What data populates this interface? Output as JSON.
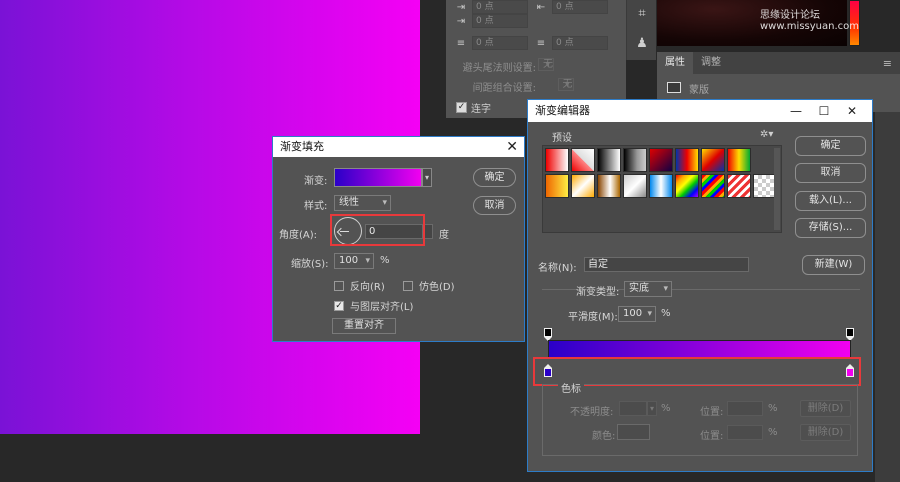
{
  "character_panel": {
    "field_1": "0 点",
    "field_2": "0 点",
    "field_3": "0 点",
    "field_4": "0 点",
    "field_5": "0 点",
    "hyphen_label": "避头尾法则设置:",
    "hyphen_value": "无",
    "spacing_label": "间距组合设置:",
    "spacing_value": "无",
    "ligature_label": "连字",
    "ligature_checked": true
  },
  "watermark": "思缘设计论坛 www.missyuan.com",
  "properties_panel": {
    "tabs": [
      "属性",
      "调整"
    ],
    "row_label": "蒙版"
  },
  "gradient_fill_dialog": {
    "title": "渐变填充",
    "gradient_label": "渐变:",
    "gradient_colors": [
      "#2a00c8",
      "#f200f0"
    ],
    "style_label": "样式:",
    "style_value": "线性",
    "angle_label": "角度(A):",
    "angle_value": "0",
    "angle_unit": "度",
    "scale_label": "缩放(S):",
    "scale_value": "100",
    "scale_unit": "%",
    "reverse_label": "反向(R)",
    "reverse_checked": false,
    "dither_label": "仿色(D)",
    "dither_checked": false,
    "align_label": "与图层对齐(L)",
    "align_checked": true,
    "reset_align_label": "重置对齐",
    "ok_label": "确定",
    "cancel_label": "取消"
  },
  "gradient_editor_dialog": {
    "title": "渐变编辑器",
    "presets_label": "预设",
    "ok_label": "确定",
    "cancel_label": "取消",
    "load_label": "载入(L)...",
    "save_label": "存储(S)...",
    "name_label": "名称(N):",
    "name_value": "自定",
    "new_label": "新建(W)",
    "type_label": "渐变类型:",
    "type_value": "实底",
    "smooth_label": "平滑度(M):",
    "smooth_value": "100",
    "smooth_unit": "%",
    "stops_group_label": "色标",
    "opacity_label": "不透明度:",
    "opacity_unit": "%",
    "location_label": "位置:",
    "location_unit": "%",
    "delete_label": "删除(D)",
    "color_label": "颜色:",
    "left_color": "#2a00c8",
    "right_color": "#f200f0"
  },
  "colors": {
    "highlight": "#e8393b",
    "dialog_border": "#2d7cc8",
    "panel_bg": "#535353"
  }
}
